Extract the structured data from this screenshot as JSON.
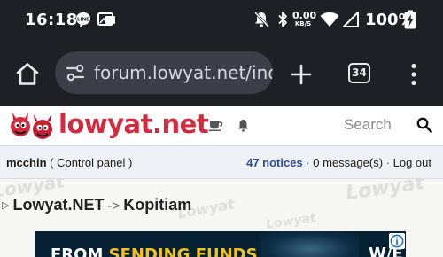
{
  "status_bar": {
    "time": "16:18",
    "data_rate": "0.00",
    "data_unit": "KB/S",
    "battery_percent": "100%"
  },
  "browser": {
    "url": "forum.lowyat.net/index.php?showtopic",
    "tab_count": "34"
  },
  "site": {
    "logo_text": "lowyat.net",
    "search_placeholder": "Search",
    "brand_color": "#d12b3f"
  },
  "user_bar": {
    "username": "mcchin",
    "control_panel": "( Control panel )",
    "notices": "47 notices",
    "separator": "·",
    "messages": "0 message(s)",
    "logout": "Log out"
  },
  "breadcrumb": {
    "items": [
      "Lowyat.NET",
      "Kopitiam"
    ],
    "separator": "->"
  },
  "ad": {
    "text_start": "FROM ",
    "text_highlight": "SENDING FUNDS",
    "logo": "W/E"
  },
  "watermark": "Lowyat",
  "icons": {
    "status": [
      "message-bubble-icon",
      "picture-icon",
      "mute-icon",
      "bluetooth-icon",
      "wifi-icon",
      "signal-icon",
      "battery-charging-icon"
    ],
    "toolbar": [
      "home-icon",
      "site-settings-icon",
      "new-tab-icon",
      "tab-switcher-icon",
      "more-menu-icon"
    ],
    "header": [
      "mascot-logo-icon",
      "cup-icon",
      "bell-icon",
      "search-icon"
    ],
    "ad": [
      "ad-info-icon"
    ]
  }
}
